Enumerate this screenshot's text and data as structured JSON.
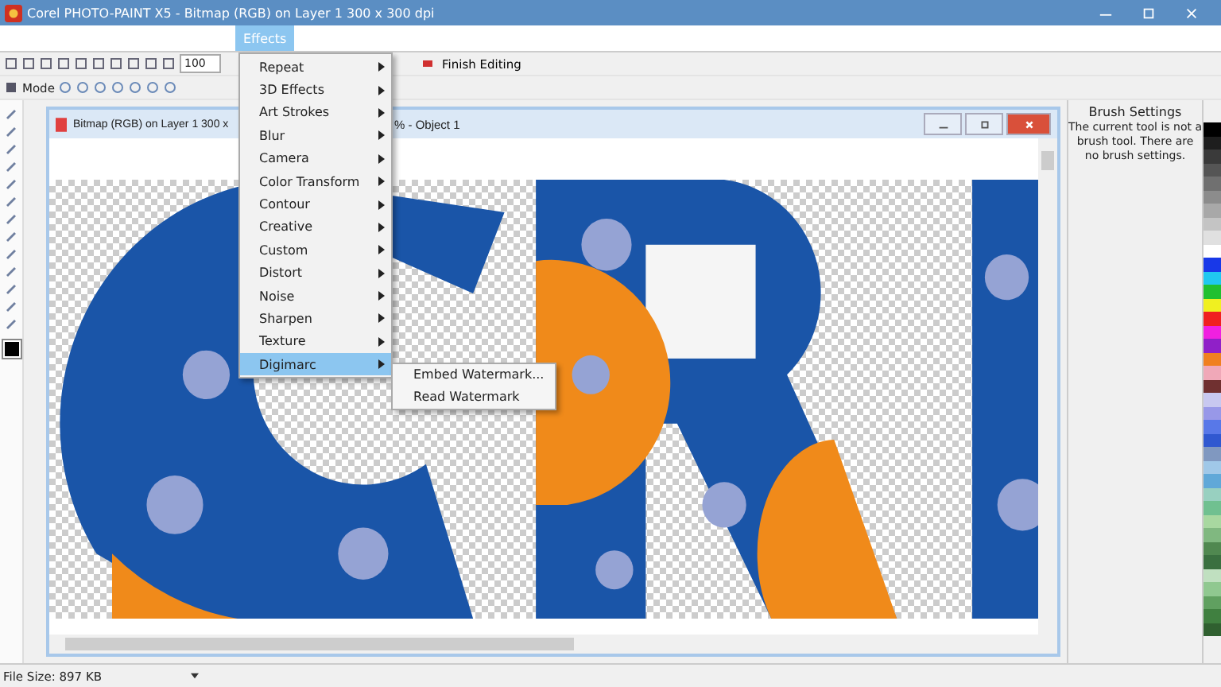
{
  "window": {
    "title": "Corel PHOTO-PAINT X5 - Bitmap (RGB) on Layer 1 300 x 300 dpi"
  },
  "menu_bar": [
    {
      "label": "Effects",
      "selected": true
    }
  ],
  "toolbar": {
    "zoom": "100",
    "finish_editing": "Finish Editing"
  },
  "property_bar": {
    "mode_label": "Mode"
  },
  "effects_menu": [
    {
      "label": "Repeat",
      "highlighted": false
    },
    {
      "label": "3D Effects",
      "highlighted": false
    },
    {
      "label": "Art Strokes",
      "highlighted": false
    },
    {
      "label": "Blur",
      "highlighted": false
    },
    {
      "label": "Camera",
      "highlighted": false
    },
    {
      "label": "Color Transform",
      "highlighted": false
    },
    {
      "label": "Contour",
      "highlighted": false
    },
    {
      "label": "Creative",
      "highlighted": false
    },
    {
      "label": "Custom",
      "highlighted": false
    },
    {
      "label": "Distort",
      "highlighted": false
    },
    {
      "label": "Noise",
      "highlighted": false
    },
    {
      "label": "Sharpen",
      "highlighted": false
    },
    {
      "label": "Texture",
      "highlighted": false
    },
    {
      "label": "Digimarc",
      "highlighted": true
    }
  ],
  "submenu": [
    "Embed Watermark...",
    "Read Watermark"
  ],
  "document": {
    "title_left": "Bitmap (RGB) on Layer 1 300 x",
    "title_right": "% - Object 1"
  },
  "docker": {
    "title": "Brush Settings",
    "message": "The current tool is not a brush tool.  There are no brush settings."
  },
  "palette": [
    {
      "color": "#000000"
    },
    {
      "color": "#1e1e1e"
    },
    {
      "color": "#3a3a3a"
    },
    {
      "color": "#555555"
    },
    {
      "color": "#707070"
    },
    {
      "color": "#8c8c8c"
    },
    {
      "color": "#a8a8a8"
    },
    {
      "color": "#c4c4c4"
    },
    {
      "color": "#e0e0e0"
    },
    {
      "color": "#ffffff"
    },
    {
      "color": "#1838e8"
    },
    {
      "color": "#20c8f0"
    },
    {
      "color": "#20c030"
    },
    {
      "color": "#f0f020"
    },
    {
      "color": "#f02020"
    },
    {
      "color": "#f020e0"
    },
    {
      "color": "#9020c8"
    },
    {
      "color": "#f08020"
    },
    {
      "color": "#f0a8b8"
    },
    {
      "color": "#703030"
    },
    {
      "color": "#c8c8f0"
    },
    {
      "color": "#9898e8"
    },
    {
      "color": "#5878e8"
    },
    {
      "color": "#3058d0"
    },
    {
      "color": "#8098c0"
    },
    {
      "color": "#a0c8e8"
    },
    {
      "color": "#60a8d8"
    },
    {
      "color": "#98d0c0"
    },
    {
      "color": "#70c090"
    },
    {
      "color": "#a8d8a0"
    },
    {
      "color": "#80b880"
    },
    {
      "color": "#508850"
    },
    {
      "color": "#3a7040"
    },
    {
      "color": "#c0e0c0"
    },
    {
      "color": "#90c890"
    },
    {
      "color": "#60a060"
    },
    {
      "color": "#408040"
    },
    {
      "color": "#306030"
    }
  ],
  "status_bar": {
    "file_size": "File Size: 897 KB"
  }
}
